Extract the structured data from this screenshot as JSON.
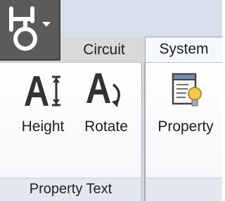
{
  "app_menu": {
    "icon": "hvac-application-menu-icon"
  },
  "tabs": [
    {
      "label": "Circuit",
      "active": false
    },
    {
      "label": "System",
      "active": true
    }
  ],
  "panels": {
    "property_text": {
      "label": "Property Text",
      "tools": [
        {
          "label": "Height",
          "icon": "text-height-icon"
        },
        {
          "label": "Rotate",
          "icon": "text-rotate-icon"
        }
      ]
    },
    "system": {
      "tools": [
        {
          "label": "Property",
          "icon": "property-bulb-icon"
        }
      ]
    }
  },
  "colors": {
    "icon_dark": "#333333",
    "bulb": "#f3c84b",
    "tab_active_bg": "#f4f7fb",
    "tab_inactive_bg": "#d9d9d9"
  }
}
